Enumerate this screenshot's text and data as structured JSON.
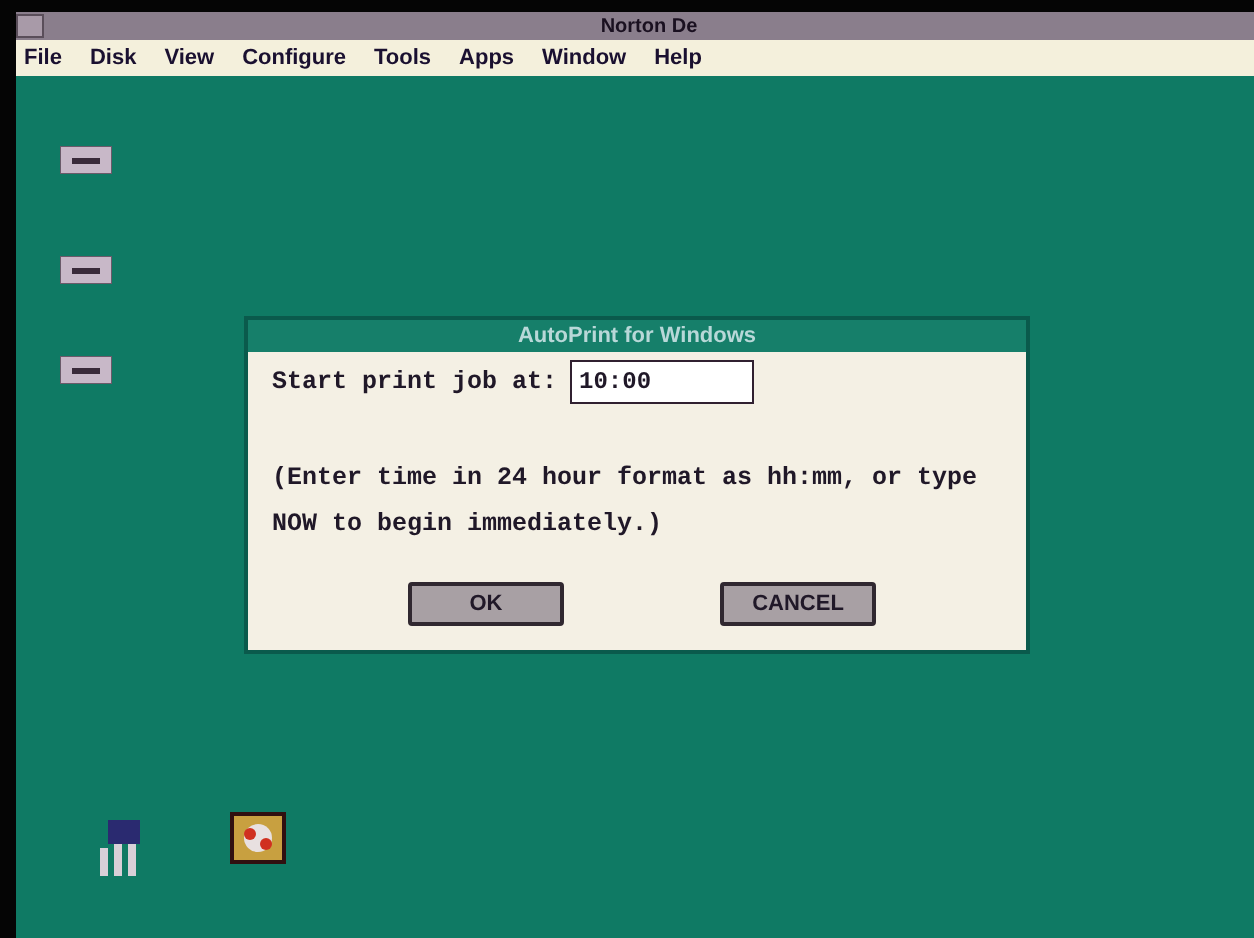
{
  "window": {
    "title": "Norton De"
  },
  "menu": [
    {
      "label": "File"
    },
    {
      "label": "Disk"
    },
    {
      "label": "View"
    },
    {
      "label": "Configure"
    },
    {
      "label": "Tools"
    },
    {
      "label": "Apps"
    },
    {
      "label": "Window"
    },
    {
      "label": "Help"
    }
  ],
  "desktop_icons": [
    {
      "kind": "drive"
    },
    {
      "kind": "drive"
    },
    {
      "kind": "drive"
    },
    {
      "kind": "group"
    },
    {
      "kind": "app"
    }
  ],
  "dialog": {
    "title": "AutoPrint for Windows",
    "prompt": "Start print job at:",
    "time_value": "10:00",
    "hint_lines": [
      "(Enter time in 24 hour format as hh:mm, or type",
      "NOW to begin immediately.)"
    ],
    "buttons": [
      {
        "label": "OK"
      },
      {
        "label": "CANCEL"
      }
    ]
  }
}
